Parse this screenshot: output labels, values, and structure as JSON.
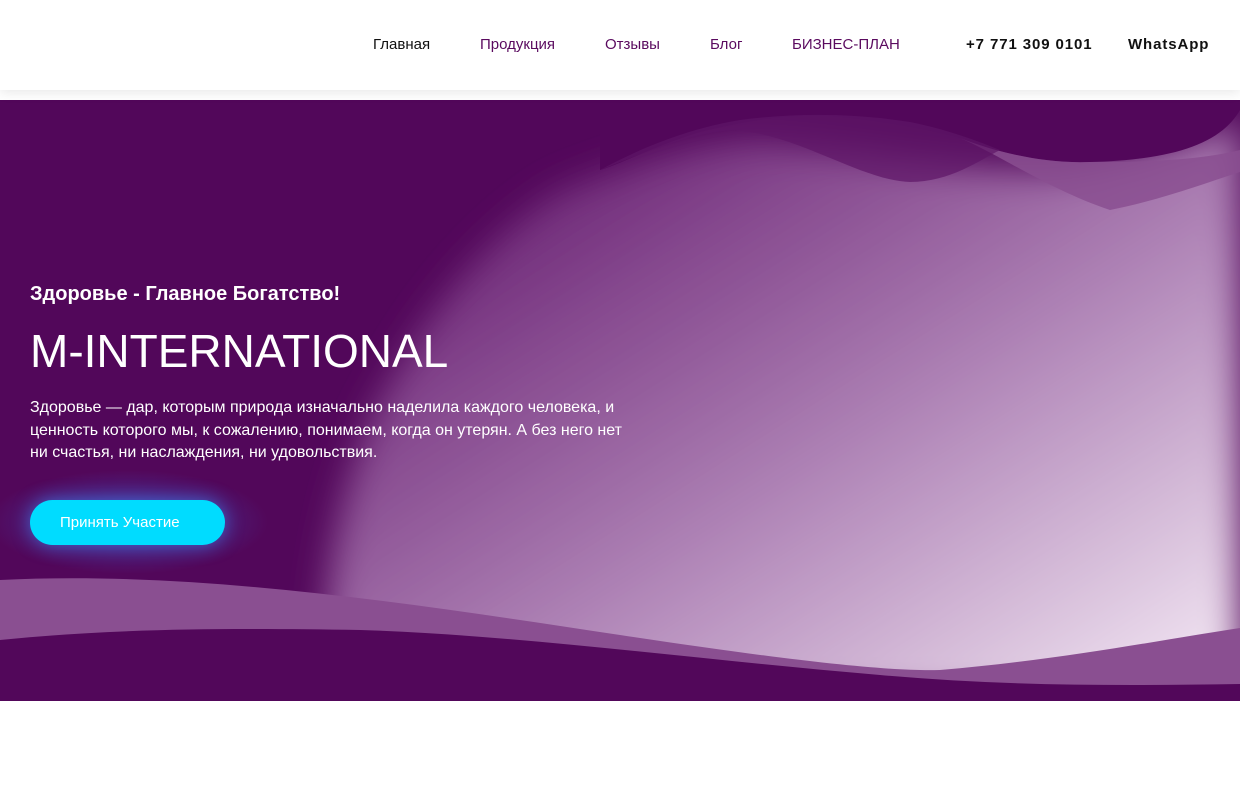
{
  "header": {
    "nav": [
      {
        "label": "Главная",
        "active": true
      },
      {
        "label": "Продукция",
        "active": false
      },
      {
        "label": "Отзывы",
        "active": false
      },
      {
        "label": "Блог",
        "active": false
      },
      {
        "label": "БИЗНЕС-ПЛАН",
        "active": false
      }
    ],
    "phone": "+7 771 309 0101",
    "whatsapp": "WhatsApp"
  },
  "hero": {
    "tagline": "Здоровье - Главное Богатство!",
    "title": "M-INTERNATIONAL",
    "description": "Здоровье — дар, которым природа изначально наделила каждого человека, и ценность которого мы, к сожалению, понимаем, когда он утерян. А без него нет ни счастья, ни наслаждения, ни удовольствия.",
    "cta_label": "Принять Участие"
  },
  "colors": {
    "hero_background": "#52075a",
    "nav_link": "#5a0a5f",
    "nav_active": "#111111",
    "cta_background": "#00dcff"
  }
}
